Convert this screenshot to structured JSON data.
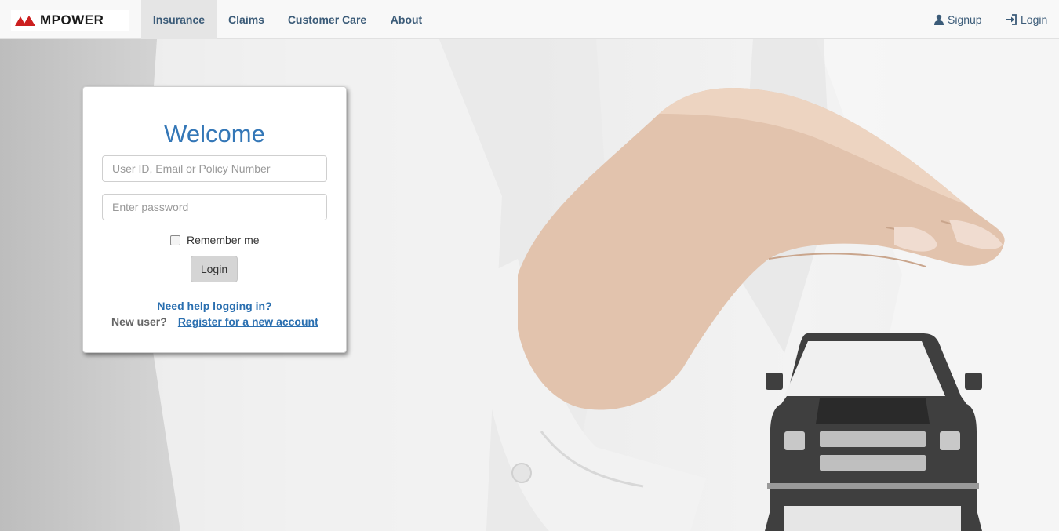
{
  "brand": {
    "name": "MPOWER",
    "accent": "#cc1f1f"
  },
  "nav": {
    "items": [
      {
        "label": "Insurance",
        "active": true
      },
      {
        "label": "Claims"
      },
      {
        "label": "Customer Care"
      },
      {
        "label": "About"
      }
    ],
    "signup": {
      "label": "Signup",
      "icon": "user-icon"
    },
    "login": {
      "label": "Login",
      "icon": "sign-in-icon"
    }
  },
  "login_card": {
    "title": "Welcome",
    "user_field": {
      "placeholder": "User ID, Email or Policy Number",
      "value": ""
    },
    "password_field": {
      "placeholder": "Enter password",
      "value": ""
    },
    "remember_label": "Remember me",
    "remember_checked": false,
    "login_button": "Login",
    "help_link": "Need help logging in?",
    "new_user_label": "New user?",
    "register_link": "Register for a new account"
  },
  "colors": {
    "title_blue": "#3477b7",
    "link_blue": "#2a6fb0",
    "nav_text": "#3b5b78"
  },
  "hero_image": "hand-over-car"
}
